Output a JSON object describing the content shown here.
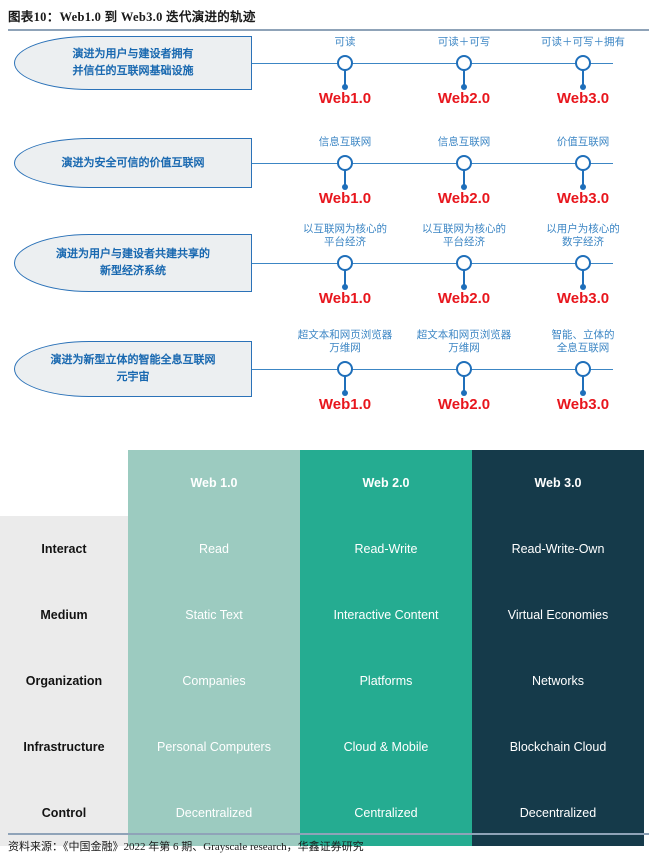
{
  "title": "图表10：Web1.0 到 Web3.0 迭代演进的轨迹",
  "footer": "资料来源：《中国金融》2022 年第 6 期、Grayscale research，华鑫证券研究",
  "colors": {
    "accent_blue": "#1868b0",
    "line_blue": "#3c86c4",
    "web_red": "#e8161d",
    "web1_col": "#9ccbc0",
    "web2_col": "#25ac91",
    "web3_col": "#153a4a",
    "rowlabel_bg": "#ebebeb",
    "shape_fill": "#eceff1"
  },
  "diagram": {
    "rows": [
      {
        "label": "演进为用户与建设者拥有\n并信任的互联网基础设施",
        "nodes": [
          {
            "caption": "可读",
            "web": "Web1.0"
          },
          {
            "caption": "可读＋可写",
            "web": "Web2.0"
          },
          {
            "caption": "可读＋可写＋拥有",
            "web": "Web3.0"
          }
        ]
      },
      {
        "label": "演进为安全可信的价值互联网",
        "nodes": [
          {
            "caption": "信息互联网",
            "web": "Web1.0"
          },
          {
            "caption": "信息互联网",
            "web": "Web2.0"
          },
          {
            "caption": "价值互联网",
            "web": "Web3.0"
          }
        ]
      },
      {
        "label": "演进为用户与建设者共建共享的\n新型经济系统",
        "nodes": [
          {
            "caption": "以互联网为核心的\n平台经济",
            "web": "Web1.0"
          },
          {
            "caption": "以互联网为核心的\n平台经济",
            "web": "Web2.0"
          },
          {
            "caption": "以用户为核心的\n数字经济",
            "web": "Web3.0"
          }
        ]
      },
      {
        "label": "演进为新型立体的智能全息互联网\n元宇宙",
        "nodes": [
          {
            "caption": "超文本和网页浏览器\n万维网",
            "web": "Web1.0"
          },
          {
            "caption": "超文本和网页浏览器\n万维网",
            "web": "Web2.0"
          },
          {
            "caption": "智能、立体的\n全息互联网",
            "web": "Web3.0"
          }
        ]
      }
    ]
  },
  "matrix": {
    "headers": [
      "",
      "Web 1.0",
      "Web 2.0",
      "Web 3.0"
    ],
    "rows": [
      {
        "label": "Interact",
        "values": [
          "Read",
          "Read-Write",
          "Read-Write-Own"
        ]
      },
      {
        "label": "Medium",
        "values": [
          "Static Text",
          "Interactive Content",
          "Virtual Economies"
        ]
      },
      {
        "label": "Organization",
        "values": [
          "Companies",
          "Platforms",
          "Networks"
        ]
      },
      {
        "label": "Infrastructure",
        "values": [
          "Personal Computers",
          "Cloud & Mobile",
          "Blockchain Cloud"
        ]
      },
      {
        "label": "Control",
        "values": [
          "Decentralized",
          "Centralized",
          "Decentralized"
        ]
      }
    ]
  }
}
